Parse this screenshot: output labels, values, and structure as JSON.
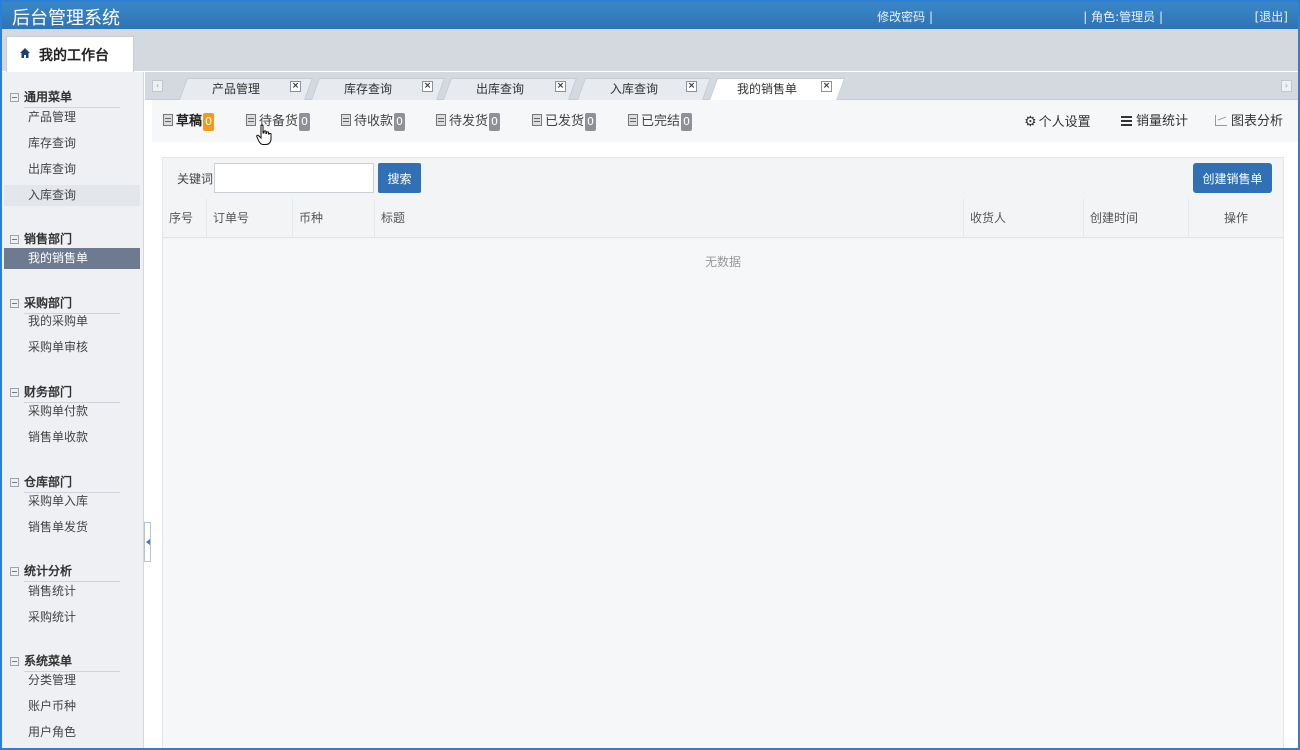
{
  "header": {
    "app_title": "后台管理系统",
    "change_password": "修改密码 |",
    "role": "| 角色:管理员 |",
    "logout": "[退出]"
  },
  "workbench": {
    "label": "我的工作台",
    "icon": "home-icon"
  },
  "sidebar": {
    "groups": [
      {
        "title": "通用菜单",
        "items": [
          "产品管理",
          "库存查询",
          "出库查询",
          "入库查询"
        ]
      },
      {
        "title": "销售部门",
        "items": [
          "我的销售单"
        ]
      },
      {
        "title": "采购部门",
        "items": [
          "我的采购单",
          "采购单审核"
        ]
      },
      {
        "title": "财务部门",
        "items": [
          "采购单付款",
          "销售单收款"
        ]
      },
      {
        "title": "仓库部门",
        "items": [
          "采购单入库",
          "销售单发货"
        ]
      },
      {
        "title": "统计分析",
        "items": [
          "销售统计",
          "采购统计"
        ]
      },
      {
        "title": "系统菜单",
        "items": [
          "分类管理",
          "账户币种",
          "用户角色"
        ]
      }
    ],
    "active_item": "我的销售单"
  },
  "tabs": [
    {
      "label": "产品管理"
    },
    {
      "label": "库存查询"
    },
    {
      "label": "出库查询"
    },
    {
      "label": "入库查询"
    },
    {
      "label": "我的销售单",
      "active": true
    }
  ],
  "status_tabs": [
    {
      "label": "草稿",
      "count": "0",
      "badge_color": "#f29a1e"
    },
    {
      "label": "待备货",
      "count": "0"
    },
    {
      "label": "待收款",
      "count": "0"
    },
    {
      "label": "待发货",
      "count": "0"
    },
    {
      "label": "已发货",
      "count": "0"
    },
    {
      "label": "已完结",
      "count": "0"
    }
  ],
  "right_links": {
    "settings": "个人设置",
    "sales_stats": "销量统计",
    "chart_analysis": "图表分析"
  },
  "search": {
    "keyword_label": "关键词",
    "keyword_value": "",
    "search_button": "搜索",
    "create_button": "创建销售单"
  },
  "table": {
    "columns": [
      "序号",
      "订单号",
      "币种",
      "标题",
      "收货人",
      "创建时间",
      "操作"
    ],
    "empty_text": "无数据"
  },
  "colors": {
    "accent": "#3270b5",
    "topbar": "#2f74b5",
    "active_menu": "#6e7a90"
  }
}
